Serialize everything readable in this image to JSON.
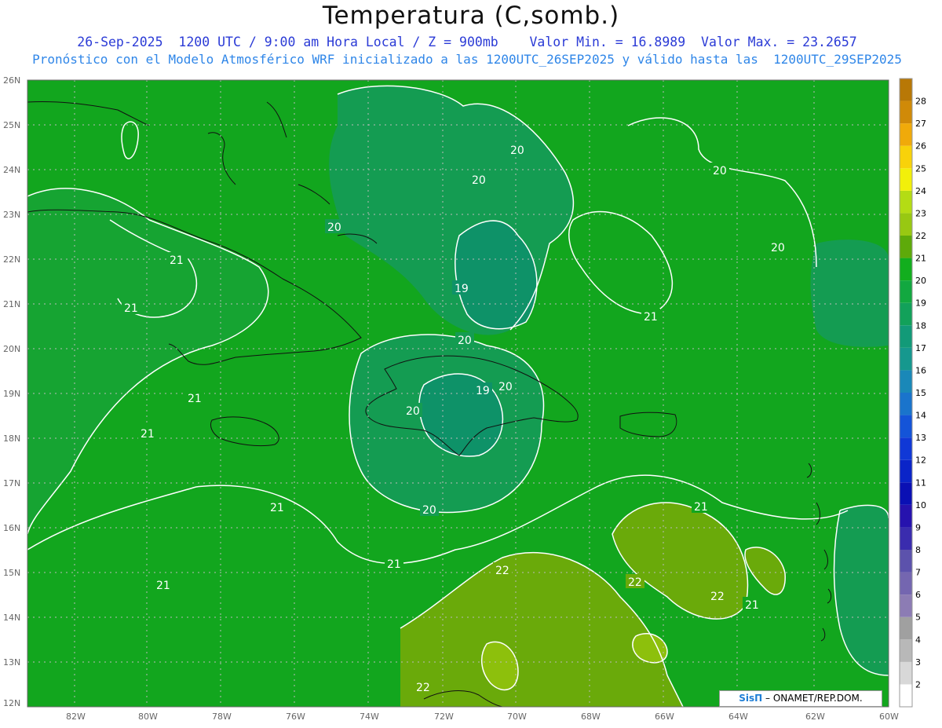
{
  "title": "Temperatura (C,somb.)",
  "header": {
    "date": "26-Sep-2025",
    "time_info": "1200 UTC / 9:00 am Hora Local / Z = 900mb",
    "min_label": "Valor Min. = 16.8989",
    "max_label": "Valor Max. = 23.2657",
    "forecast_note": "Pronóstico con el Modelo Atmosférico WRF inicializado a las 1200UTC_26SEP2025 y válido hasta las  1200UTC_29SEP2025"
  },
  "axes": {
    "lat_labels": [
      "26N",
      "25N",
      "24N",
      "23N",
      "22N",
      "21N",
      "20N",
      "19N",
      "18N",
      "17N",
      "16N",
      "15N",
      "14N",
      "13N",
      "12N"
    ],
    "lon_labels": [
      "82W",
      "80W",
      "78W",
      "76W",
      "74W",
      "72W",
      "70W",
      "68W",
      "66W",
      "64W",
      "62W",
      "60W"
    ]
  },
  "colorbar": {
    "labels": [
      "2",
      "3",
      "4",
      "5",
      "6",
      "7",
      "8",
      "9",
      "10",
      "11",
      "12",
      "13",
      "14",
      "15",
      "16",
      "17",
      "18",
      "19",
      "20",
      "21",
      "22",
      "23",
      "24",
      "25",
      "26",
      "27",
      "28"
    ],
    "colors": [
      "#ffffff",
      "#d8d8d8",
      "#b8b8b8",
      "#a0a0a0",
      "#8c7cb4",
      "#7466b0",
      "#5c52ac",
      "#3a2cae",
      "#2612ae",
      "#0a10b4",
      "#0a24c8",
      "#1038d6",
      "#1454d8",
      "#1a74cc",
      "#1a88b8",
      "#16988e",
      "#129a78",
      "#12a15a",
      "#12a840",
      "#12ae1e",
      "#5eaa0a",
      "#98c812",
      "#b4dc14",
      "#f2f00a",
      "#f8d20a",
      "#f0aa0a",
      "#d08a08",
      "#b87806"
    ]
  },
  "contour_labels": [
    "20",
    "20",
    "20",
    "20",
    "20",
    "20",
    "20",
    "20",
    "20",
    "19",
    "19",
    "21",
    "21",
    "21",
    "21",
    "21",
    "21",
    "21",
    "21",
    "21",
    "21",
    "22",
    "22",
    "22",
    "22"
  ],
  "credit": {
    "brand": "SisΠ",
    "text": " – ONAMET/REP.DOM."
  }
}
